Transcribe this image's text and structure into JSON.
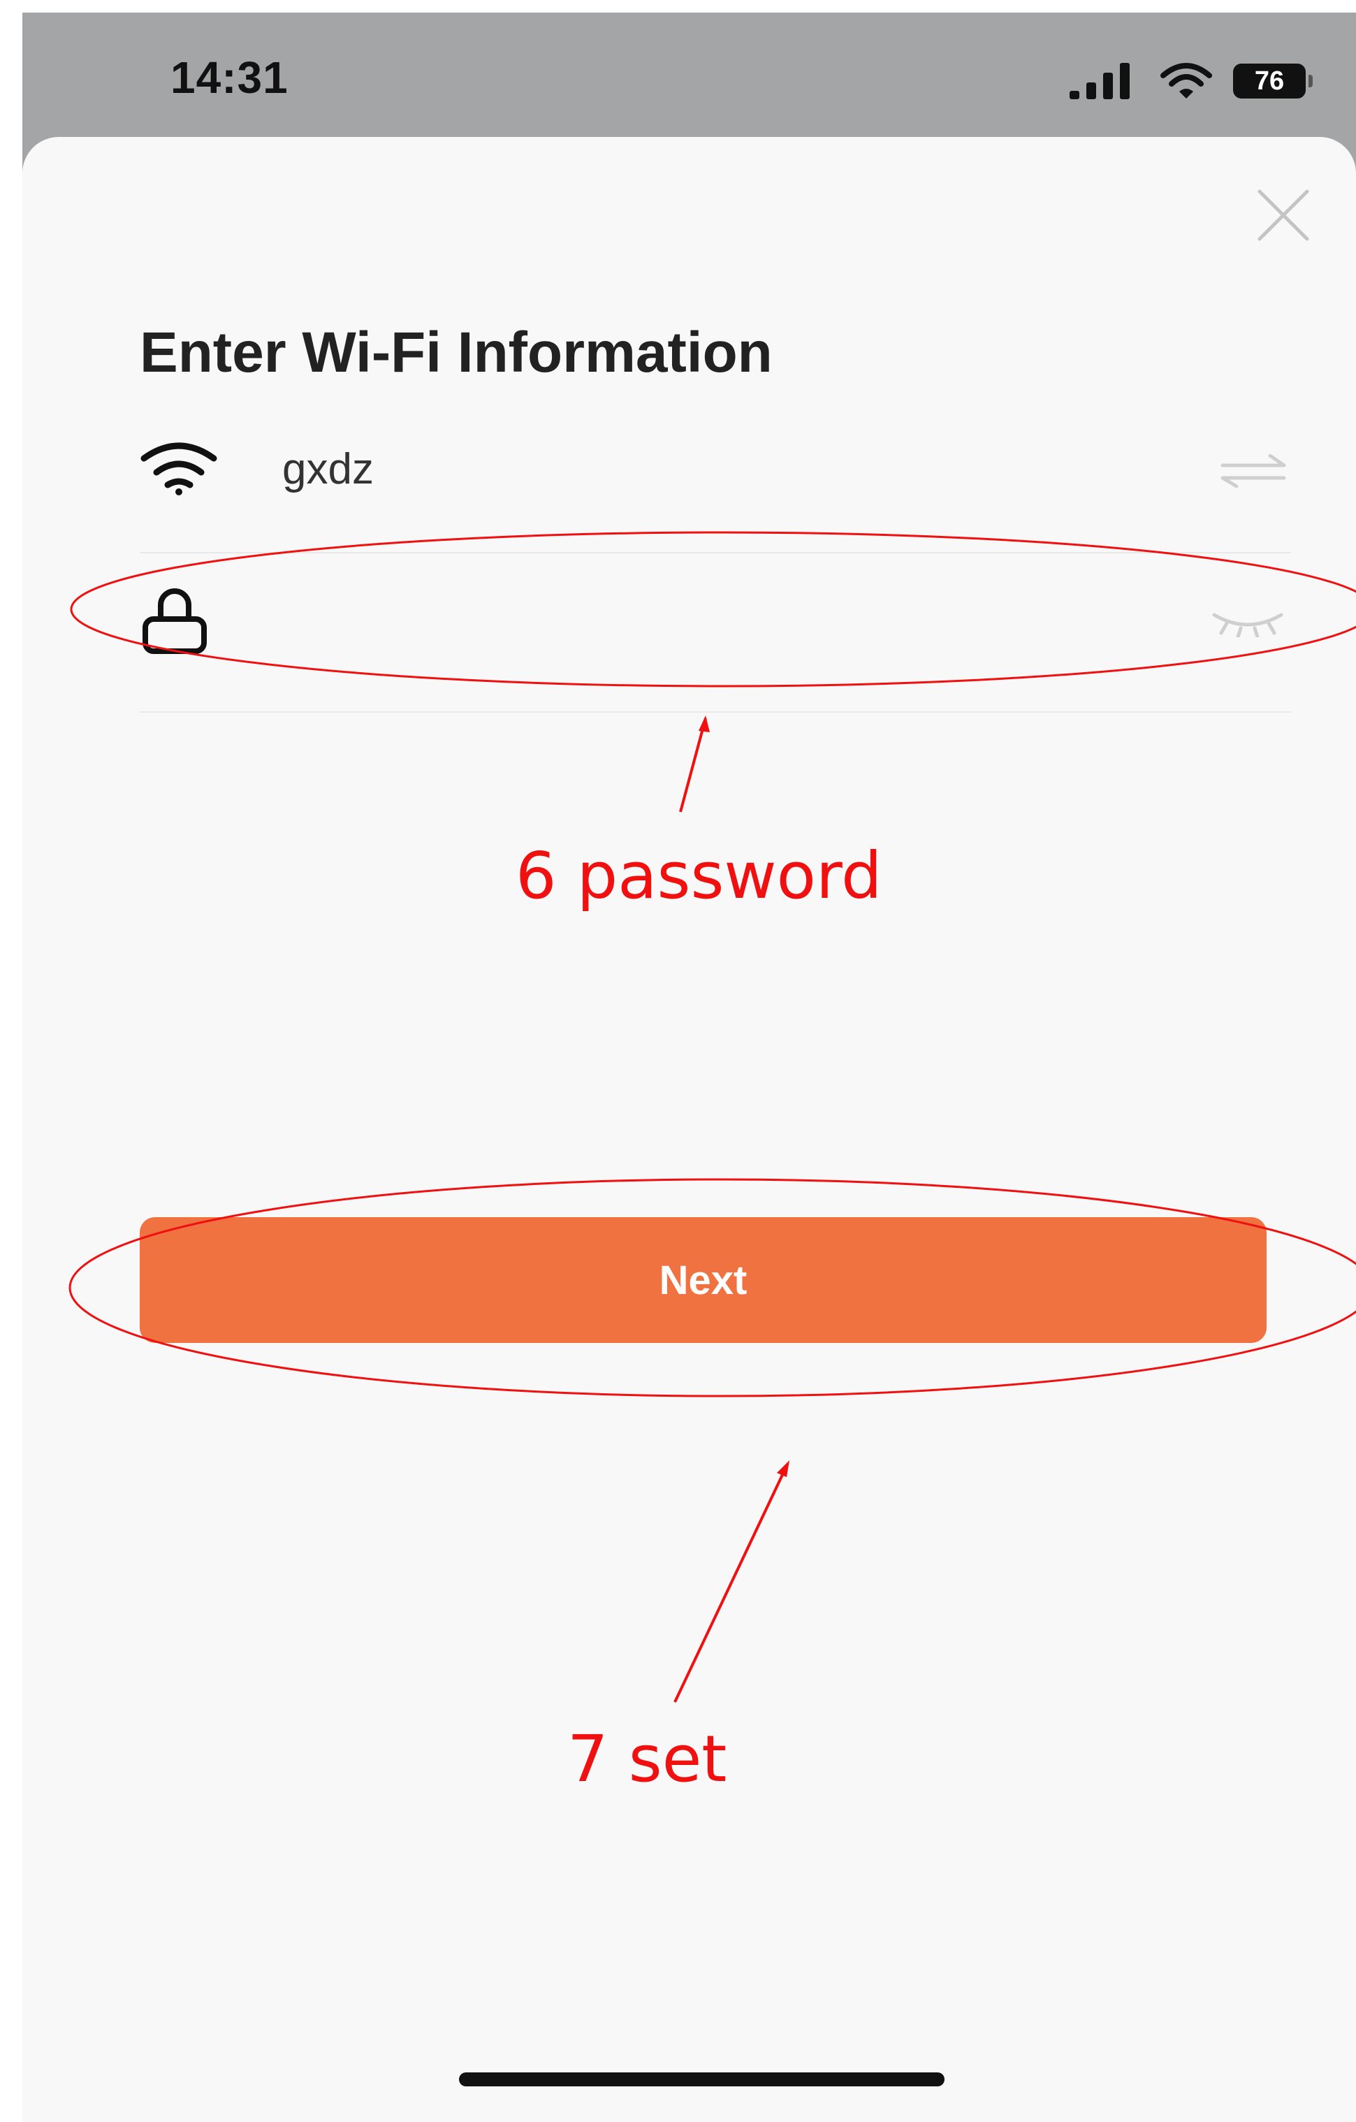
{
  "status_bar": {
    "time": "14:31",
    "battery_level": "76"
  },
  "header": {
    "title": "Enter Wi-Fi Information"
  },
  "wifi": {
    "ssid": "gxdz"
  },
  "password": {
    "value": "",
    "placeholder": ""
  },
  "actions": {
    "next_label": "Next"
  },
  "annotations": [
    {
      "label": "6 password"
    },
    {
      "label": "7 set"
    }
  ],
  "colors": {
    "accent": "#ef7240",
    "annotation": "#f01010",
    "status_bar_bg": "#a4a5a6",
    "sheet_bg": "#f8f8f8"
  },
  "icons": {
    "close": "close-icon",
    "wifi": "wifi-icon",
    "switch_network": "switch-network-icon",
    "lock": "lock-icon",
    "password_visibility": "eye-closed-icon"
  }
}
